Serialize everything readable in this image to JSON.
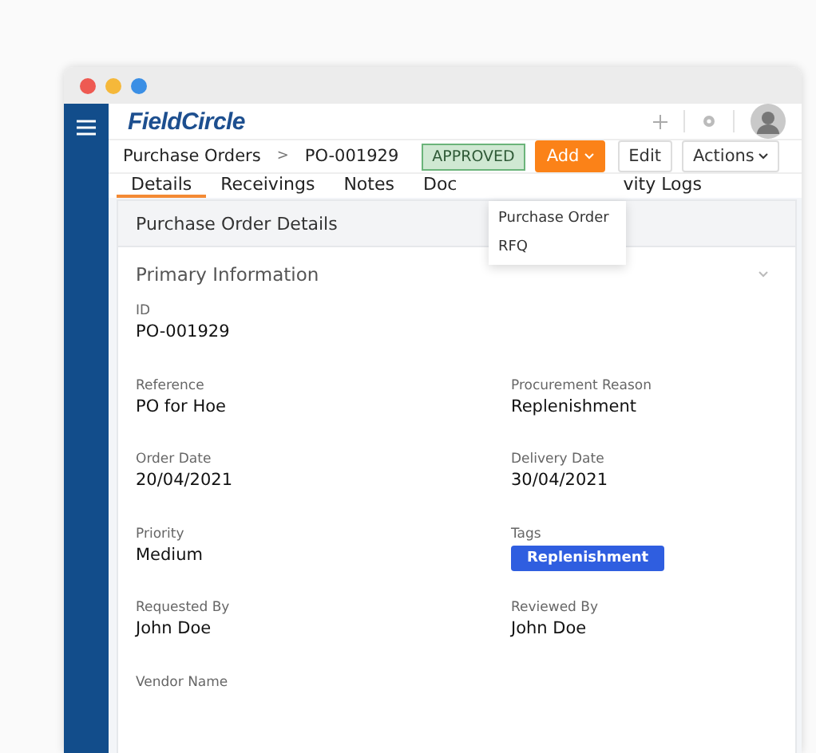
{
  "brand": {
    "logo": "FieldCircle"
  },
  "breadcrumb": {
    "parent": "Purchase Orders",
    "separator": ">",
    "current": "PO-001929"
  },
  "status_badge": "APPROVED",
  "actions": [
    {
      "label": "Add",
      "kind": "primary",
      "caret": true
    },
    {
      "label": "Edit",
      "kind": "plain",
      "caret": false
    },
    {
      "label": "Actions",
      "kind": "plain",
      "caret": true
    }
  ],
  "add_menu": {
    "open": true,
    "items": [
      "Purchase Order",
      "RFQ"
    ]
  },
  "tabs": [
    {
      "label": "Details",
      "selected": true
    },
    {
      "label": "Receivings",
      "selected": false
    },
    {
      "label": "Notes",
      "selected": false
    },
    {
      "label": "Doc",
      "selected": false
    },
    {
      "label": "vity Logs",
      "selected": false
    }
  ],
  "panel": {
    "title": "Purchase Order Details",
    "section": "Primary Information",
    "expanded": true
  },
  "fields": [
    [
      {
        "label": "ID",
        "value": "PO-001929",
        "kind": "text"
      }
    ],
    [
      {
        "label": "Reference",
        "value": "PO for Hoe",
        "kind": "text"
      },
      {
        "label": "Procurement Reason",
        "value": "Replenishment",
        "kind": "text"
      }
    ],
    [
      {
        "label": "Order Date",
        "value": "20/04/2021",
        "kind": "text"
      },
      {
        "label": "Delivery Date",
        "value": "30/04/2021",
        "kind": "text"
      }
    ],
    [
      {
        "label": "Priority",
        "value": "Medium",
        "kind": "text"
      },
      {
        "label": "Tags",
        "value": "Replenishment",
        "kind": "tag",
        "color": "#2f5ee0"
      }
    ],
    [
      {
        "label": "Requested By",
        "value": "John Doe",
        "kind": "text"
      },
      {
        "label": "Reviewed By",
        "value": "John Doe",
        "kind": "text"
      }
    ],
    [
      {
        "label": "Vendor Name",
        "kind": "text"
      }
    ]
  ]
}
